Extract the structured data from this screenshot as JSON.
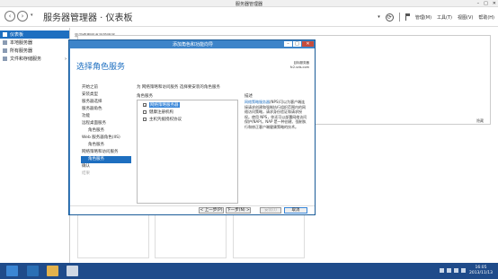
{
  "window": {
    "title": "服务器管理器",
    "min": "–",
    "max": "□",
    "close": "✕"
  },
  "header": {
    "title": "服务器管理器 · 仪表板",
    "back": "‹",
    "forward": "›",
    "dropdown": "▾",
    "refresh": "⟳",
    "menus": [
      "管理(M)",
      "工具(T)",
      "视图(V)",
      "帮助(H)"
    ]
  },
  "sidebar": {
    "items": [
      {
        "label": "仪表板",
        "active": true
      },
      {
        "label": "本地服务器",
        "active": false
      },
      {
        "label": "所有服务器",
        "active": false
      },
      {
        "label": "文件和存储服务",
        "active": false,
        "chevron": "›"
      }
    ]
  },
  "main": {
    "welcome": "欢迎使用服务器管理器",
    "hide": "隐藏"
  },
  "dialog": {
    "title": "添加角色和功能向导",
    "heading": "选择角色服务",
    "destination_label": "目标服务器",
    "destination_server": "fc2-vds.com",
    "instruction": "为 网络策略和访问服务 选择要安装的角色服务",
    "role_services_label": "角色服务",
    "description_label": "描述",
    "description_highlight": "网络策略服务器",
    "description_text": "(NPS)可以为客户端连接请求创建和强制执行组织范围内的网络访问策略，请求身份验证和请求授权。使用 NPS，你还可以部署网络访问保护(NAP)。NAP 是一种创建、强制执行和修正客户端健康策略的技术。",
    "steps": [
      {
        "label": "开始之前",
        "state": "normal"
      },
      {
        "label": "安装类型",
        "state": "normal"
      },
      {
        "label": "服务器选择",
        "state": "normal"
      },
      {
        "label": "服务器角色",
        "state": "normal"
      },
      {
        "label": "功能",
        "state": "normal"
      },
      {
        "label": "远程桌面服务",
        "state": "normal"
      },
      {
        "label": "角色服务",
        "state": "sub"
      },
      {
        "label": "Web 服务器角色(IIS)",
        "state": "normal"
      },
      {
        "label": "角色服务",
        "state": "sub"
      },
      {
        "label": "网络策略和访问服务",
        "state": "normal"
      },
      {
        "label": "角色服务",
        "state": "active"
      },
      {
        "label": "确认",
        "state": "normal"
      },
      {
        "label": "结果",
        "state": "disabled"
      }
    ],
    "role_services": [
      {
        "label": "网络策略服务器",
        "checked": true,
        "selected": true
      },
      {
        "label": "健康注册机构",
        "checked": false,
        "selected": false
      },
      {
        "label": "主机凭据授权协议",
        "checked": false,
        "selected": false
      }
    ],
    "buttons": {
      "prev": "< 上一步(P)",
      "next": "下一步(N) >",
      "install": "安装(I)",
      "cancel": "取消"
    }
  },
  "taskbar": {
    "time": "16:05",
    "date": "2013/11/13"
  }
}
